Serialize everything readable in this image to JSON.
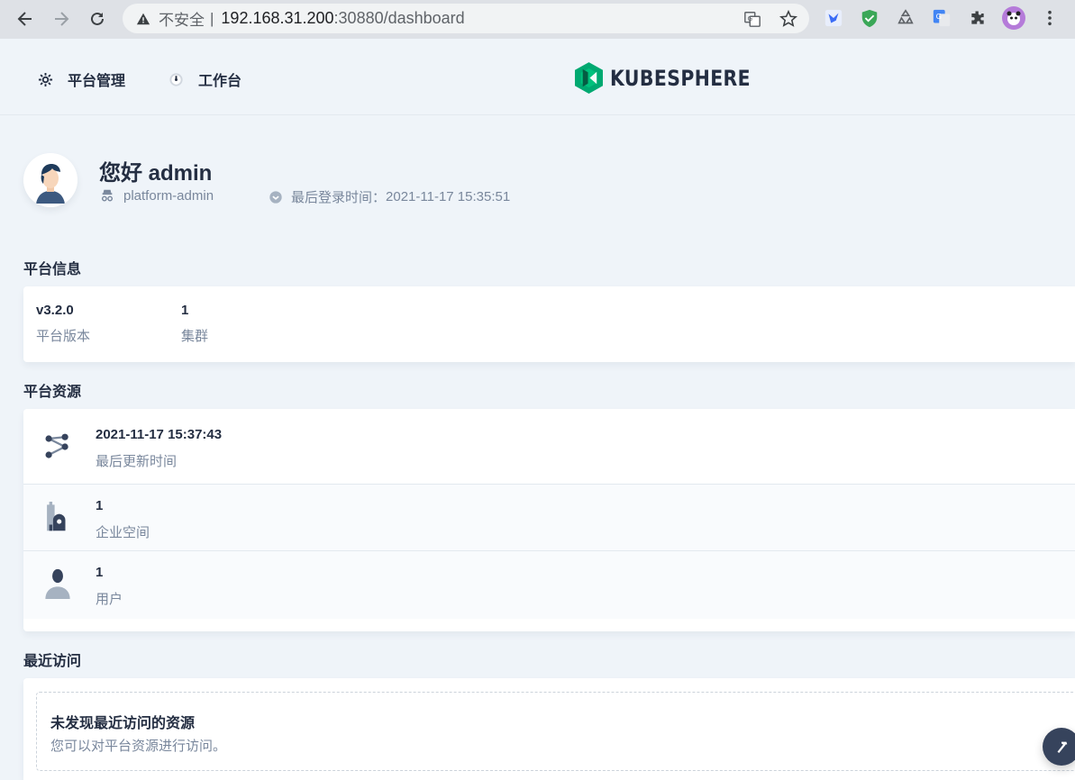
{
  "browser": {
    "security_label": "不安全",
    "separator": "|",
    "url_host": "192.168.31.200",
    "url_path": ":30880/dashboard"
  },
  "nav": {
    "platform_label": "平台管理",
    "workbench_label": "工作台",
    "logo_text": "KUBESPHERE"
  },
  "profile": {
    "greeting": "您好 admin",
    "role": "platform-admin",
    "last_login_label": "最后登录时间：",
    "last_login_time": "2021-11-17 15:35:51"
  },
  "platform_info": {
    "title": "平台信息",
    "items": [
      {
        "value": "v3.2.0",
        "label": "平台版本"
      },
      {
        "value": "1",
        "label": "集群"
      }
    ]
  },
  "platform_resources": {
    "title": "平台资源",
    "rows": [
      {
        "icon": "topology-icon",
        "value": "2021-11-17 15:37:43",
        "label": "最后更新时间"
      },
      {
        "icon": "workspace-icon",
        "value": "1",
        "label": "企业空间"
      },
      {
        "icon": "user-icon",
        "value": "1",
        "label": "用户"
      }
    ]
  },
  "recent": {
    "title": "最近访问",
    "empty_title": "未发现最近访问的资源",
    "empty_desc": "您可以对平台资源进行访问。"
  },
  "colors": {
    "background": "#eff4f9",
    "text_primary": "#242e42",
    "text_secondary": "#79879c",
    "brand_green": "#00a971"
  }
}
